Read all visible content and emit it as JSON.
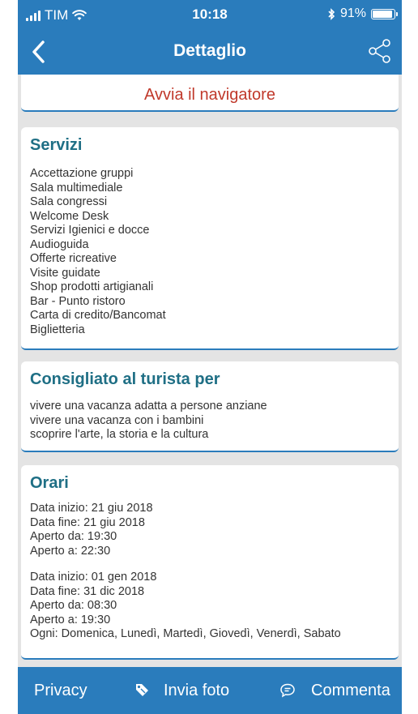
{
  "status_bar": {
    "carrier": "TIM",
    "time": "10:18",
    "bluetooth_icon": "bluetooth-icon",
    "battery": "91%",
    "battery_level": 0.91
  },
  "nav": {
    "title": "Dettaglio",
    "back_icon": "chevron-left-icon",
    "share_icon": "share-icon"
  },
  "navigator": {
    "label": "Avvia il navigatore"
  },
  "services": {
    "title": "Servizi",
    "items": [
      "Accettazione gruppi",
      "Sala multimediale",
      "Sala congressi",
      "Welcome Desk",
      "Servizi Igienici e docce",
      "Audioguida",
      "Offerte ricreative",
      "Visite guidate",
      "Shop prodotti artigianali",
      "Bar - Punto ristoro",
      "Carta di credito/Bancomat",
      "Biglietteria"
    ]
  },
  "tourist": {
    "title": "Consigliato al turista per",
    "items": [
      "vivere una vacanza adatta a persone anziane",
      "vivere una vacanza con i bambini",
      "scoprire l'arte, la storia e la cultura"
    ]
  },
  "hours": {
    "title": "Orari",
    "blocks": [
      {
        "start": "Data inizio: 21 giu 2018",
        "end": "Data fine: 21 giu 2018",
        "open_from": "Aperto da: 19:30",
        "open_to": "Aperto a: 22:30"
      },
      {
        "start": "Data inizio: 01 gen 2018",
        "end": "Data fine: 31 dic 2018",
        "open_from": "Aperto da: 08:30",
        "open_to": "Aperto a: 19:30",
        "days": "Ogni: Domenica, Lunedì, Martedì, Giovedì, Venerdì, Sabato"
      }
    ]
  },
  "tab_bar": {
    "privacy": "Privacy",
    "photo": "Invia foto",
    "photo_icon": "tag-icon",
    "comment": "Commenta",
    "comment_icon": "chat-bubble-icon"
  },
  "colors": {
    "primary": "#2a7cbc",
    "section_title": "#1f6f85",
    "navigator_link": "#c0392b",
    "background": "#e4e4e4"
  }
}
